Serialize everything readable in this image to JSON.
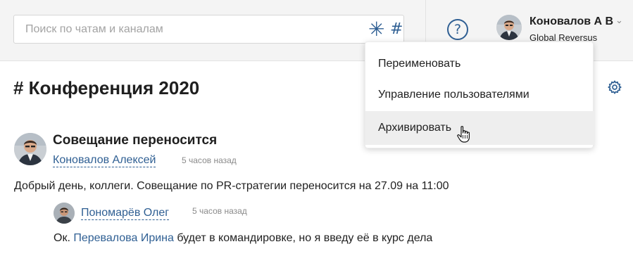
{
  "search": {
    "placeholder": "Поиск по чатам и каналам",
    "asterisk_glyph": "✳",
    "hash_glyph": "#"
  },
  "header": {
    "help_glyph": "?",
    "user": {
      "name": "Коновалов А В",
      "organization": "Global Reversus",
      "chevron": "⌄"
    }
  },
  "channel": {
    "title": "# Конференция 2020"
  },
  "context_menu": {
    "items": [
      {
        "label": "Переименовать"
      },
      {
        "label": "Управление пользователями"
      },
      {
        "label": "Архивировать"
      }
    ],
    "hovered_index": 2
  },
  "post": {
    "title": "Совещание переносится",
    "author": "Коновалов Алексей",
    "time": "5 часов назад",
    "body": "Добрый день, коллеги. Совещание по PR-стратегии переносится на 27.09 на 11:00"
  },
  "reply": {
    "author": "Пономарёв Олег",
    "time": "5 часов назад",
    "body_prefix": "Ок. ",
    "mention": "Перевалова Ирина",
    "body_suffix": " будет в командировке, но я введу её в курс дела"
  },
  "colors": {
    "accent": "#2f5f93",
    "topbar_bg": "#f4f4f4",
    "menu_hover_bg": "#eeeeee",
    "muted_text": "#8a8a8a"
  },
  "icons": {
    "search_star": "asterisk-icon",
    "channel_hash": "hash-icon",
    "help": "question-circle-icon",
    "settings": "gear-icon",
    "expand": "chevron-down-icon",
    "pointer": "hand-cursor-icon"
  }
}
